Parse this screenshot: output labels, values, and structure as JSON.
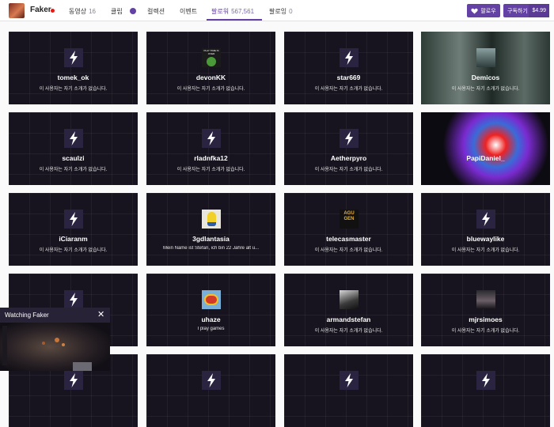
{
  "channel": {
    "name": "Faker",
    "live": true
  },
  "tabs": [
    {
      "label": "동영상",
      "count": "16",
      "active": false
    },
    {
      "label": "클립",
      "count": "",
      "active": false
    },
    {
      "label": "컬렉션",
      "count": "",
      "active": false
    },
    {
      "label": "이벤트",
      "count": "",
      "active": false
    },
    {
      "label": "팔로워",
      "count": "567,561",
      "active": true
    },
    {
      "label": "팔로잉",
      "count": "0",
      "active": false
    }
  ],
  "buttons": {
    "follow": "팔로우",
    "subscribe": "구독하기",
    "price": "$4.99"
  },
  "colors": {
    "brand": "#6441a4",
    "live": "#e91916",
    "card_bg": "#17141f"
  },
  "followers": [
    {
      "name": "tomek_ok",
      "bio": "이 사용자는 자기 소개가 없습니다.",
      "avatar": "bolt-icon"
    },
    {
      "name": "devonKK",
      "bio": "이 사용자는 자기 소개가 없습니다.",
      "avatar": "meme",
      "avatar_text": "PLAY TIME IS OVER"
    },
    {
      "name": "star669",
      "bio": "이 사용자는 자기 소개가 없습니다.",
      "avatar": "bolt-icon"
    },
    {
      "name": "Demicos",
      "bio": "이 사용자는 자기 소개가 없습니다.",
      "avatar": "photo",
      "cover": "green"
    },
    {
      "name": "scaulzi",
      "bio": "이 사용자는 자기 소개가 없습니다.",
      "avatar": "bolt-icon"
    },
    {
      "name": "rladnfka12",
      "bio": "이 사용자는 자기 소개가 없습니다.",
      "avatar": "bolt-icon"
    },
    {
      "name": "Aetherpyro",
      "bio": "이 사용자는 자기 소개가 없습니다.",
      "avatar": "bolt-icon"
    },
    {
      "name": "PapiDaniel_",
      "bio": "",
      "avatar": "none",
      "cover": "splash"
    },
    {
      "name": "iCiaranm",
      "bio": "이 사용자는 자기 소개가 없습니다.",
      "avatar": "bolt-icon"
    },
    {
      "name": "3gdlantasia",
      "bio": "Mein Name ist Stefan, ich bin 22 Jahre alt u...",
      "avatar": "minion"
    },
    {
      "name": "telecasmaster",
      "bio": "이 사용자는 자기 소개가 없습니다.",
      "avatar": "logo",
      "avatar_text": "AGU GEN"
    },
    {
      "name": "bluewaylike",
      "bio": "이 사용자는 자기 소개가 없습니다.",
      "avatar": "bolt-icon"
    },
    {
      "name": "",
      "bio": "",
      "avatar": "bolt-icon"
    },
    {
      "name": "uhaze",
      "bio": "I play games",
      "avatar": "badge"
    },
    {
      "name": "armandstefan",
      "bio": "이 사용자는 자기 소개가 없습니다.",
      "avatar": "dark-photo"
    },
    {
      "name": "mjrsimoes",
      "bio": "이 사용자는 자기 소개가 없습니다.",
      "avatar": "photo-dark"
    },
    {
      "name": "",
      "bio": "",
      "avatar": "bolt-icon"
    },
    {
      "name": "",
      "bio": "",
      "avatar": "bolt-icon"
    },
    {
      "name": "",
      "bio": "",
      "avatar": "bolt-icon"
    },
    {
      "name": "",
      "bio": "",
      "avatar": "bolt-icon"
    }
  ],
  "mini_player": {
    "title": "Watching Faker"
  }
}
